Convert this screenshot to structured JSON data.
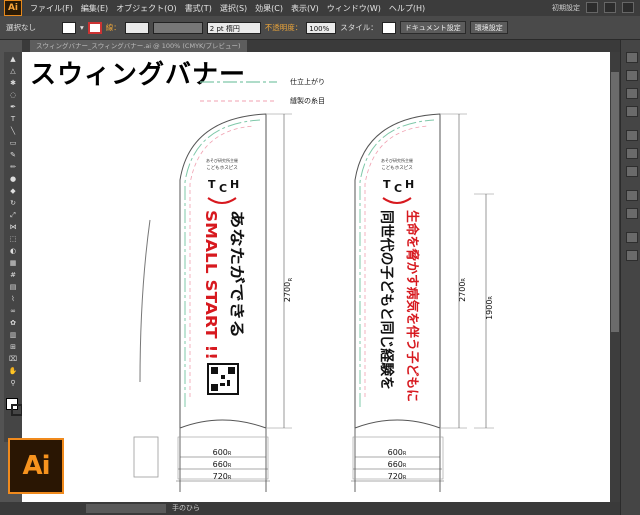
{
  "app": {
    "logo": "Ai",
    "workspace": "初期設定"
  },
  "menu": [
    "ファイル(F)",
    "編集(E)",
    "オブジェクト(O)",
    "書式(T)",
    "選択(S)",
    "効果(C)",
    "表示(V)",
    "ウィンドウ(W)",
    "ヘルプ(H)"
  ],
  "control": {
    "selection": "選択なし",
    "stroke_label": "線：",
    "stroke_weight": "2 pt 楕円",
    "opacity_label": "不透明度：",
    "opacity_value": "100%",
    "style_label": "スタイル：",
    "doc_settings": "ドキュメント設定",
    "prefs": "環境設定"
  },
  "document": {
    "tab": "スウィングバナー_スウィングバナー.ai @ 100% (CMYK/プレビュー)"
  },
  "status": {
    "tool": "手のひら"
  },
  "artwork": {
    "title": "スウィングバナー",
    "legend": {
      "trim": "仕立上がり",
      "seam": "縫製の糸目"
    },
    "banner1": {
      "org_small": "あそび研究所主催",
      "org_name": "こどもホスピス",
      "logo": [
        "T",
        "C",
        "H"
      ],
      "black_text": "あなたができる",
      "red_text": "SMALL START !!",
      "height": "2700",
      "widths": [
        "600",
        "660",
        "720"
      ]
    },
    "banner2": {
      "org_small": "あそび研究所主催",
      "org_name": "こどもホスピス",
      "logo": [
        "T",
        "C",
        "H"
      ],
      "red_text": "生命を脅かす病気を伴う子どもに",
      "black_text": "同世代の子どもと同じ経験を",
      "height": "2700",
      "sub_height": "1900"
    },
    "unit": "R",
    "colors": {
      "red": "#d7191f",
      "black": "#111111",
      "trim": "#7fc8a9",
      "seam": "#f0a0b0",
      "accent": "#f7931e"
    }
  }
}
